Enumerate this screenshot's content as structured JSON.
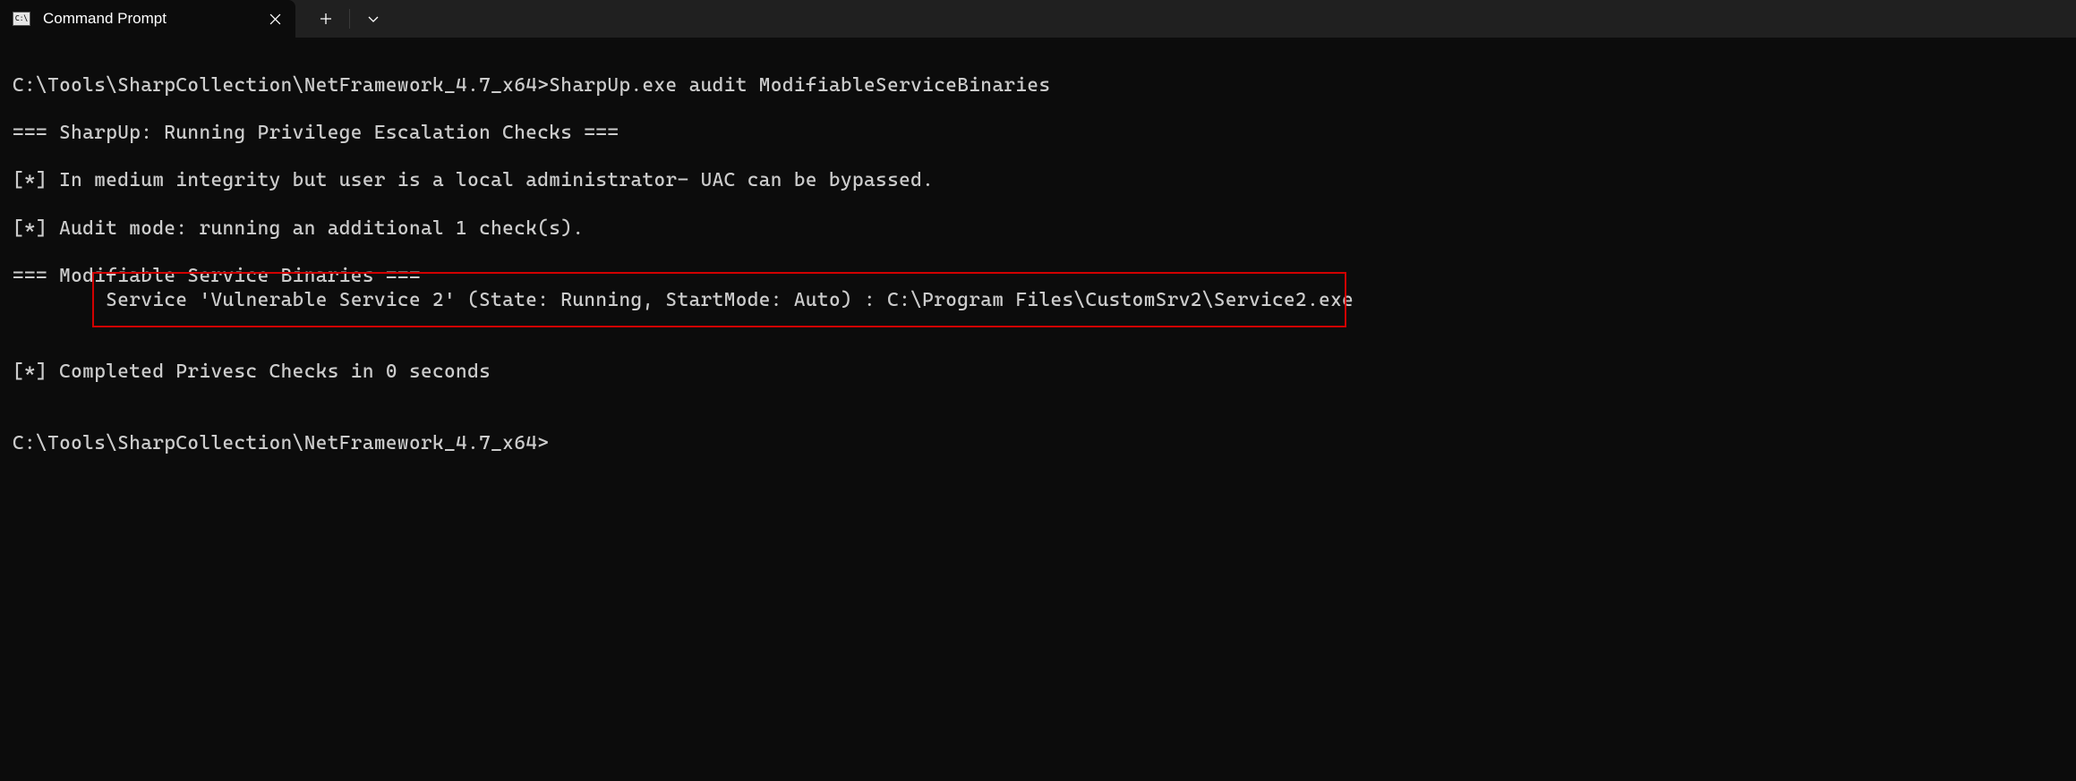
{
  "titlebar": {
    "tab_title": "Command Prompt"
  },
  "terminal": {
    "prompt": "C:\\Tools\\SharpCollection\\NetFramework_4.7_x64>",
    "command": "SharpUp.exe audit ModifiableServiceBinaries",
    "line_header": "=== SharpUp: Running Privilege Escalation Checks ===",
    "line_integrity": "[*] In medium integrity but user is a local administrator- UAC can be bypassed.",
    "line_audit": "[*] Audit mode: running an additional 1 check(s).",
    "line_section": "=== Modifiable Service Binaries ===",
    "line_service": "\tService 'Vulnerable Service 2' (State: Running, StartMode: Auto) : C:\\Program Files\\CustomSrv2\\Service2.exe",
    "line_completed": "[*] Completed Privesc Checks in 0 seconds",
    "prompt2": "C:\\Tools\\SharpCollection\\NetFramework_4.7_x64>"
  }
}
